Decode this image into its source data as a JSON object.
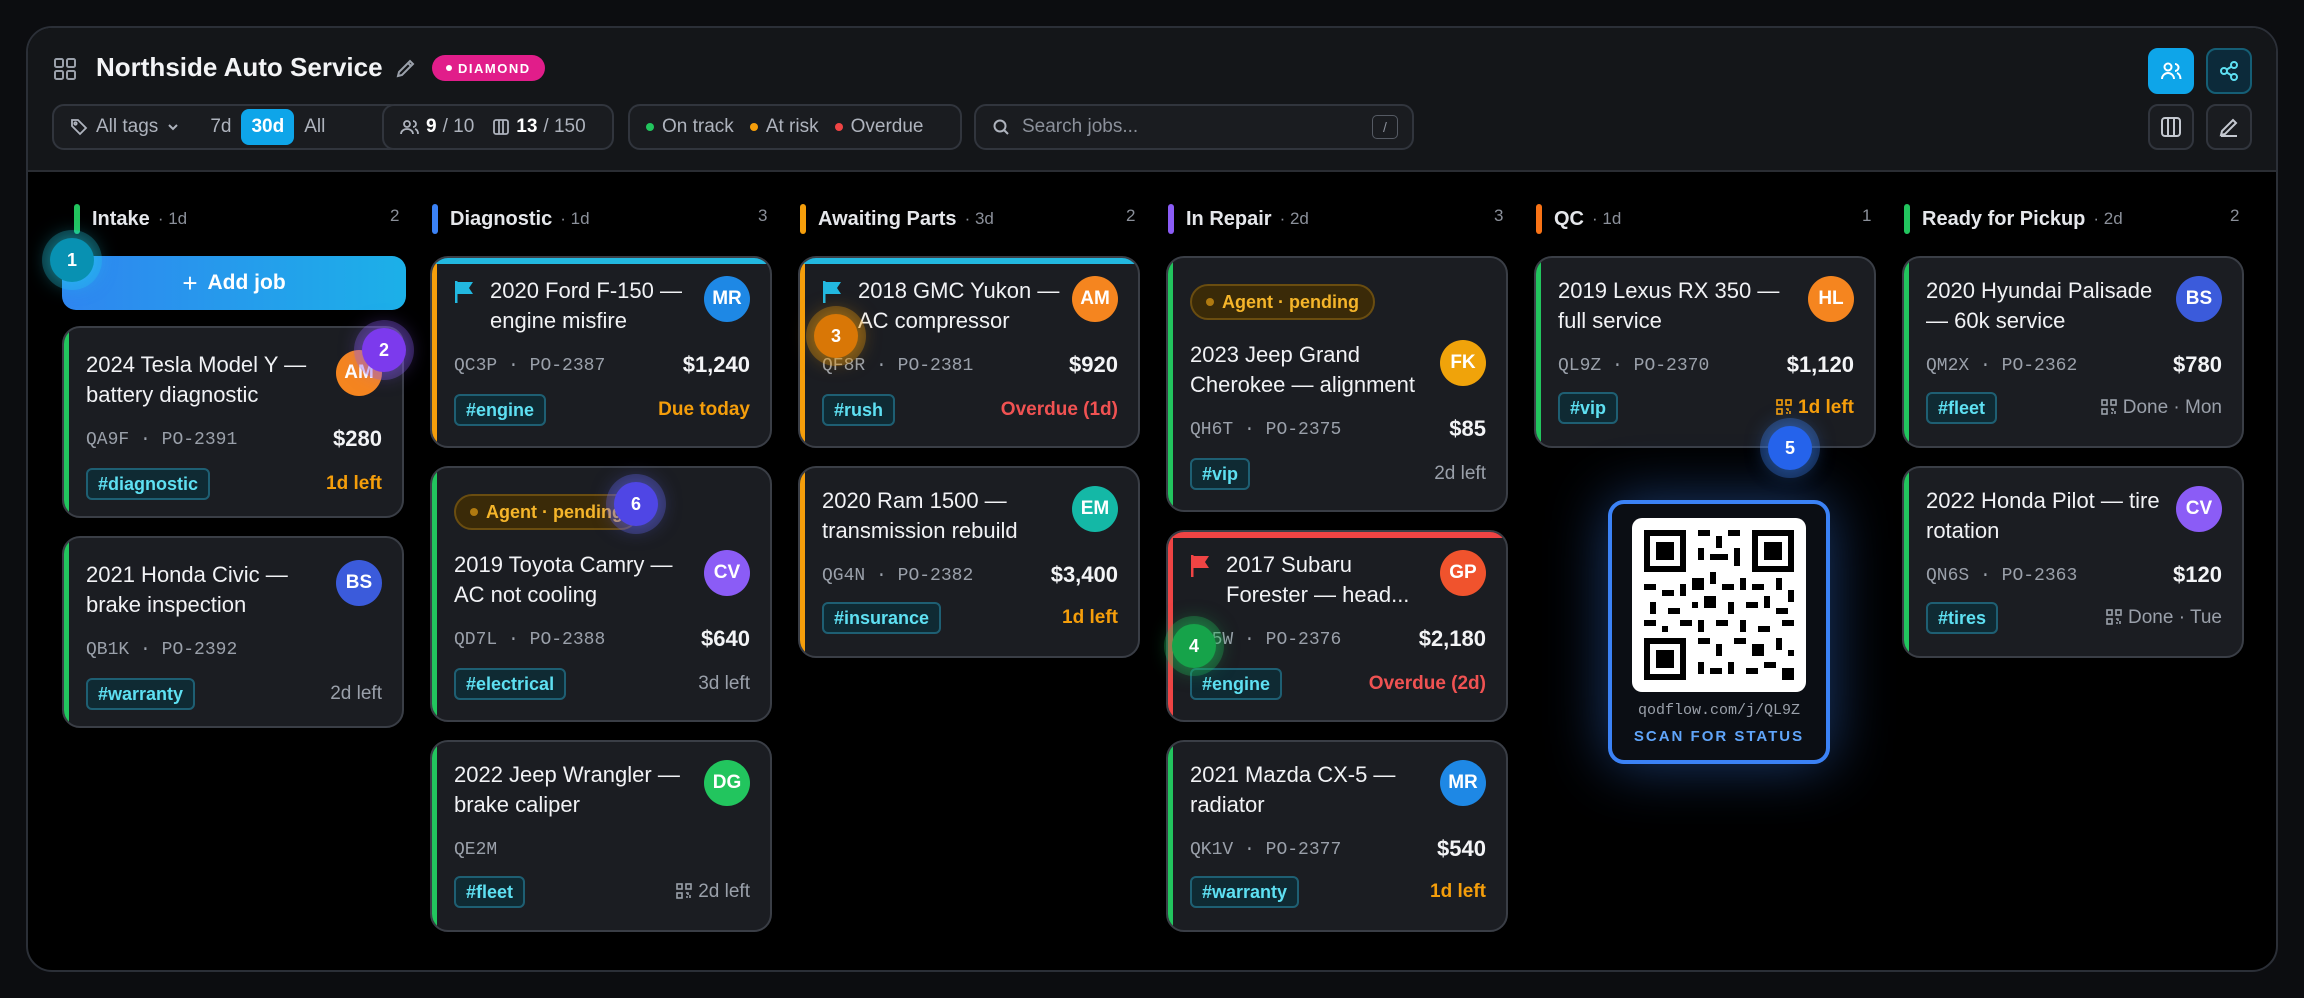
{
  "header": {
    "title": "Northside Auto Service",
    "badge": "DIAMOND",
    "tags_filter": "All tags",
    "ranges": [
      "7d",
      "30d",
      "All"
    ],
    "active_range": "30d",
    "people_count": "9",
    "people_total": "/ 10",
    "jobs_count": "13",
    "jobs_total": "/ 150",
    "legend": [
      "On track",
      "At risk",
      "Overdue"
    ],
    "search_placeholder": "Search jobs...",
    "search_shortcut": "/"
  },
  "columns": [
    {
      "name": "Intake",
      "age": "· 1d",
      "count": "2",
      "color": "#22c55e"
    },
    {
      "name": "Diagnostic",
      "age": "· 1d",
      "count": "3",
      "color": "#3b82f6"
    },
    {
      "name": "Awaiting Parts",
      "age": "· 3d",
      "count": "2",
      "color": "#f59e0b"
    },
    {
      "name": "In Repair",
      "age": "· 2d",
      "count": "3",
      "color": "#8b5cf6"
    },
    {
      "name": "QC",
      "age": "· 1d",
      "count": "1",
      "color": "#f97316"
    },
    {
      "name": "Ready for Pickup",
      "age": "· 2d",
      "count": "2",
      "color": "#22c55e"
    }
  ],
  "add_job_label": "Add job",
  "cards": [
    {
      "title": "2024 Tesla Model Y — battery diagnostic",
      "avatar": "AM",
      "code": "QA9F",
      "po": "PO-2391",
      "price": "$280",
      "tag": "#diagnostic",
      "due": "1d left"
    },
    {
      "title": "2021 Honda Civic — brake inspection",
      "avatar": "BS",
      "code": "QB1K",
      "po": "PO-2392",
      "price": "",
      "tag": "#warranty",
      "due": "2d left"
    },
    {
      "title": "2020 Ford F-150 — engine misfire",
      "avatar": "MR",
      "code": "QC3P",
      "po": "PO-2387",
      "price": "$1,240",
      "tag": "#engine",
      "due": "Due today"
    },
    {
      "agent": "Agent · pending",
      "title": "2019 Toyota Camry — AC not cooling",
      "avatar": "CV",
      "code": "QD7L",
      "po": "PO-2388",
      "price": "$640",
      "tag": "#electrical",
      "due": "3d left"
    },
    {
      "title": "2022 Jeep Wrangler — brake caliper",
      "avatar": "DG",
      "code": "QE2M",
      "po": "",
      "price": "",
      "tag": "#fleet",
      "due": "2d left"
    },
    {
      "title": "2018 GMC Yukon — AC compressor",
      "avatar": "AM",
      "code": "QF8R",
      "po": "PO-2381",
      "price": "$920",
      "tag": "#rush",
      "due": "Overdue (1d)"
    },
    {
      "title": "2020 Ram 1500 — transmission rebuild",
      "avatar": "EM",
      "code": "QG4N",
      "po": "PO-2382",
      "price": "$3,400",
      "tag": "#insurance",
      "due": "1d left"
    },
    {
      "agent": "Agent · pending",
      "title": "2023 Jeep Grand Cherokee — alignment",
      "avatar": "FK",
      "code": "QH6T",
      "po": "PO-2375",
      "price": "$85",
      "tag": "#vip",
      "due": "2d left"
    },
    {
      "title": "2017 Subaru Forester — head...",
      "avatar": "GP",
      "code": "QJ5W",
      "po": "PO-2376",
      "price": "$2,180",
      "tag": "#engine",
      "due": "Overdue (2d)"
    },
    {
      "title": "2021 Mazda CX-5 — radiator",
      "avatar": "MR",
      "code": "QK1V",
      "po": "PO-2377",
      "price": "$540",
      "tag": "#warranty",
      "due": "1d left"
    },
    {
      "title": "2019 Lexus RX 350 — full service",
      "avatar": "HL",
      "code": "QL9Z",
      "po": "PO-2370",
      "price": "$1,120",
      "tag": "#vip",
      "due": "1d left"
    },
    {
      "title": "2020 Hyundai Palisade — 60k service",
      "avatar": "BS",
      "code": "QM2X",
      "po": "PO-2362",
      "price": "$780",
      "tag": "#fleet",
      "due": "Done · Mon"
    },
    {
      "title": "2022 Honda Pilot — tire rotation",
      "avatar": "CV",
      "code": "QN6S",
      "po": "PO-2363",
      "price": "$120",
      "tag": "#tires",
      "due": "Done · Tue"
    }
  ],
  "qr": {
    "url": "qodflow.com/j/QL9Z",
    "caption": "SCAN FOR STATUS"
  },
  "markers": [
    "1",
    "2",
    "3",
    "4",
    "5",
    "6"
  ],
  "sep": "·"
}
